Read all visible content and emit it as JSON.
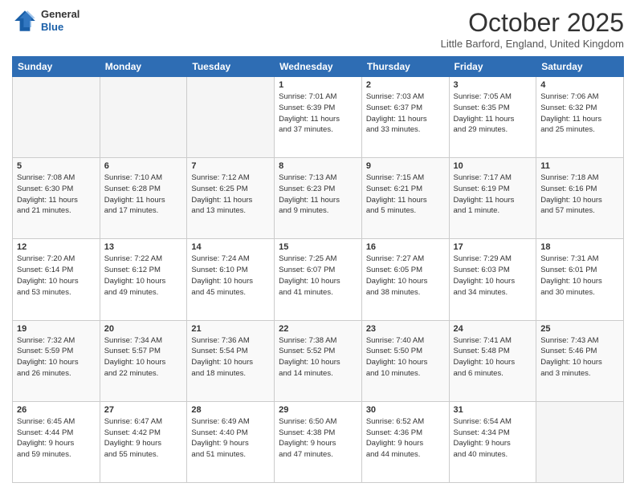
{
  "logo": {
    "line1": "General",
    "line2": "Blue"
  },
  "header": {
    "month": "October 2025",
    "location": "Little Barford, England, United Kingdom"
  },
  "weekdays": [
    "Sunday",
    "Monday",
    "Tuesday",
    "Wednesday",
    "Thursday",
    "Friday",
    "Saturday"
  ],
  "weeks": [
    [
      {
        "day": "",
        "info": ""
      },
      {
        "day": "",
        "info": ""
      },
      {
        "day": "",
        "info": ""
      },
      {
        "day": "1",
        "info": "Sunrise: 7:01 AM\nSunset: 6:39 PM\nDaylight: 11 hours\nand 37 minutes."
      },
      {
        "day": "2",
        "info": "Sunrise: 7:03 AM\nSunset: 6:37 PM\nDaylight: 11 hours\nand 33 minutes."
      },
      {
        "day": "3",
        "info": "Sunrise: 7:05 AM\nSunset: 6:35 PM\nDaylight: 11 hours\nand 29 minutes."
      },
      {
        "day": "4",
        "info": "Sunrise: 7:06 AM\nSunset: 6:32 PM\nDaylight: 11 hours\nand 25 minutes."
      }
    ],
    [
      {
        "day": "5",
        "info": "Sunrise: 7:08 AM\nSunset: 6:30 PM\nDaylight: 11 hours\nand 21 minutes."
      },
      {
        "day": "6",
        "info": "Sunrise: 7:10 AM\nSunset: 6:28 PM\nDaylight: 11 hours\nand 17 minutes."
      },
      {
        "day": "7",
        "info": "Sunrise: 7:12 AM\nSunset: 6:25 PM\nDaylight: 11 hours\nand 13 minutes."
      },
      {
        "day": "8",
        "info": "Sunrise: 7:13 AM\nSunset: 6:23 PM\nDaylight: 11 hours\nand 9 minutes."
      },
      {
        "day": "9",
        "info": "Sunrise: 7:15 AM\nSunset: 6:21 PM\nDaylight: 11 hours\nand 5 minutes."
      },
      {
        "day": "10",
        "info": "Sunrise: 7:17 AM\nSunset: 6:19 PM\nDaylight: 11 hours\nand 1 minute."
      },
      {
        "day": "11",
        "info": "Sunrise: 7:18 AM\nSunset: 6:16 PM\nDaylight: 10 hours\nand 57 minutes."
      }
    ],
    [
      {
        "day": "12",
        "info": "Sunrise: 7:20 AM\nSunset: 6:14 PM\nDaylight: 10 hours\nand 53 minutes."
      },
      {
        "day": "13",
        "info": "Sunrise: 7:22 AM\nSunset: 6:12 PM\nDaylight: 10 hours\nand 49 minutes."
      },
      {
        "day": "14",
        "info": "Sunrise: 7:24 AM\nSunset: 6:10 PM\nDaylight: 10 hours\nand 45 minutes."
      },
      {
        "day": "15",
        "info": "Sunrise: 7:25 AM\nSunset: 6:07 PM\nDaylight: 10 hours\nand 41 minutes."
      },
      {
        "day": "16",
        "info": "Sunrise: 7:27 AM\nSunset: 6:05 PM\nDaylight: 10 hours\nand 38 minutes."
      },
      {
        "day": "17",
        "info": "Sunrise: 7:29 AM\nSunset: 6:03 PM\nDaylight: 10 hours\nand 34 minutes."
      },
      {
        "day": "18",
        "info": "Sunrise: 7:31 AM\nSunset: 6:01 PM\nDaylight: 10 hours\nand 30 minutes."
      }
    ],
    [
      {
        "day": "19",
        "info": "Sunrise: 7:32 AM\nSunset: 5:59 PM\nDaylight: 10 hours\nand 26 minutes."
      },
      {
        "day": "20",
        "info": "Sunrise: 7:34 AM\nSunset: 5:57 PM\nDaylight: 10 hours\nand 22 minutes."
      },
      {
        "day": "21",
        "info": "Sunrise: 7:36 AM\nSunset: 5:54 PM\nDaylight: 10 hours\nand 18 minutes."
      },
      {
        "day": "22",
        "info": "Sunrise: 7:38 AM\nSunset: 5:52 PM\nDaylight: 10 hours\nand 14 minutes."
      },
      {
        "day": "23",
        "info": "Sunrise: 7:40 AM\nSunset: 5:50 PM\nDaylight: 10 hours\nand 10 minutes."
      },
      {
        "day": "24",
        "info": "Sunrise: 7:41 AM\nSunset: 5:48 PM\nDaylight: 10 hours\nand 6 minutes."
      },
      {
        "day": "25",
        "info": "Sunrise: 7:43 AM\nSunset: 5:46 PM\nDaylight: 10 hours\nand 3 minutes."
      }
    ],
    [
      {
        "day": "26",
        "info": "Sunrise: 6:45 AM\nSunset: 4:44 PM\nDaylight: 9 hours\nand 59 minutes."
      },
      {
        "day": "27",
        "info": "Sunrise: 6:47 AM\nSunset: 4:42 PM\nDaylight: 9 hours\nand 55 minutes."
      },
      {
        "day": "28",
        "info": "Sunrise: 6:49 AM\nSunset: 4:40 PM\nDaylight: 9 hours\nand 51 minutes."
      },
      {
        "day": "29",
        "info": "Sunrise: 6:50 AM\nSunset: 4:38 PM\nDaylight: 9 hours\nand 47 minutes."
      },
      {
        "day": "30",
        "info": "Sunrise: 6:52 AM\nSunset: 4:36 PM\nDaylight: 9 hours\nand 44 minutes."
      },
      {
        "day": "31",
        "info": "Sunrise: 6:54 AM\nSunset: 4:34 PM\nDaylight: 9 hours\nand 40 minutes."
      },
      {
        "day": "",
        "info": ""
      }
    ]
  ]
}
